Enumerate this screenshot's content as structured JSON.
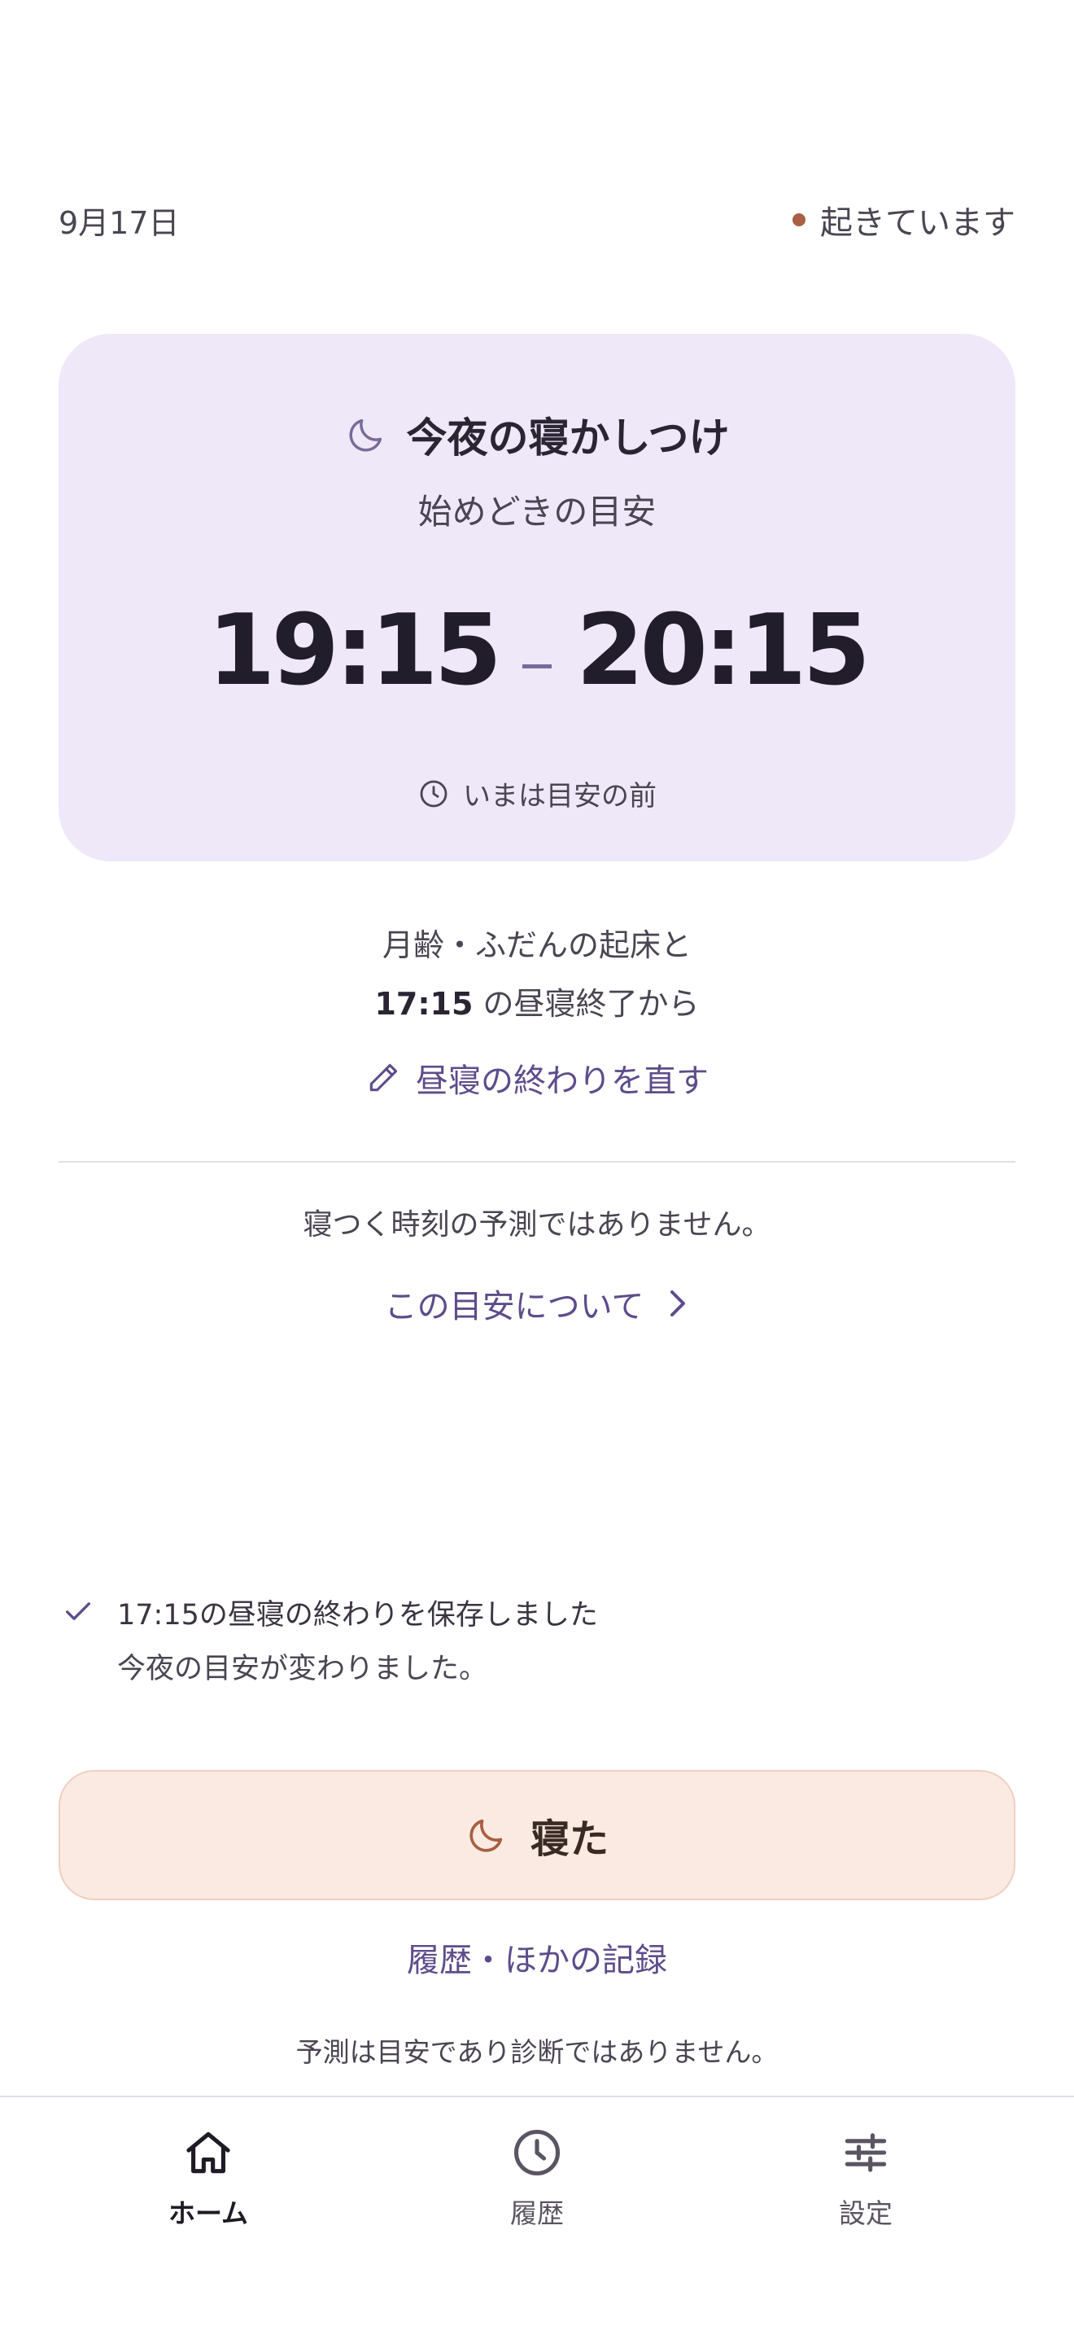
{
  "header": {
    "date": "9月17日",
    "status": "起きています",
    "status_color": "#a85f43"
  },
  "card": {
    "icon": "moon-icon",
    "title": "今夜の寝かしつけ",
    "subtitle": "始めどきの目安",
    "window_start": "19:15",
    "window_end": "20:15",
    "note_icon": "clock-icon",
    "note": "いまは目安の前",
    "background": "#efe8f8"
  },
  "basis": {
    "line1": "月齢・ふだんの起床と",
    "nap_end_time": "17:15",
    "line2_suffix": " の昼寝終了から"
  },
  "edit_link": {
    "icon": "pencil-icon",
    "label": "昼寝の終わりを直す"
  },
  "disclaimer": "寝つく時刻の予測ではありません。",
  "about_link": {
    "label": "この目安について",
    "icon": "chevron-right-icon"
  },
  "toast": {
    "icon": "check-icon",
    "line1": "17:15の昼寝の終わりを保存しました",
    "line2": "今夜の目安が変わりました。"
  },
  "slept_button": {
    "icon": "moon-icon",
    "label": "寝た",
    "background": "#fbeae2"
  },
  "history_link": "履歴・ほかの記録",
  "footer_note": "予測は目安であり診断ではありません。",
  "nav": {
    "items": [
      {
        "icon": "home-icon",
        "label": "ホーム",
        "active": true
      },
      {
        "icon": "history-clock-icon",
        "label": "履歴",
        "active": false
      },
      {
        "icon": "sliders-icon",
        "label": "設定",
        "active": false
      }
    ]
  },
  "accent_color": "#5e4c8a"
}
